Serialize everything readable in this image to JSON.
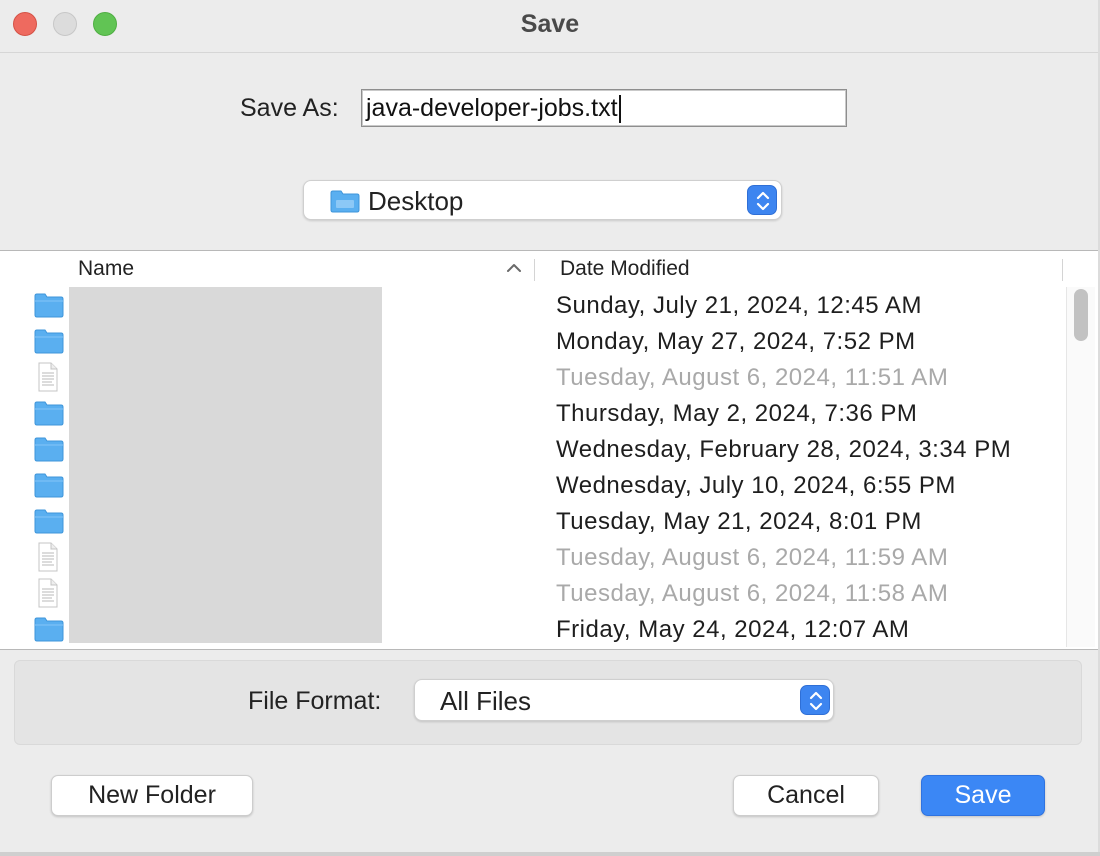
{
  "window": {
    "title": "Save"
  },
  "save_as": {
    "label": "Save As:",
    "value": "java-developer-jobs.txt"
  },
  "location": {
    "label": "Desktop",
    "icon": "folder-icon"
  },
  "browser": {
    "columns": {
      "name": "Name",
      "date_modified": "Date Modified"
    },
    "sort": "ascending",
    "rows": [
      {
        "type": "folder",
        "date": "Sunday, July 21, 2024, 12:45 AM",
        "enabled": true
      },
      {
        "type": "folder",
        "date": "Monday, May 27, 2024, 7:52 PM",
        "enabled": true
      },
      {
        "type": "file",
        "date": "Tuesday, August 6, 2024, 11:51 AM",
        "enabled": false
      },
      {
        "type": "folder",
        "date": "Thursday, May 2, 2024, 7:36 PM",
        "enabled": true
      },
      {
        "type": "folder",
        "date": "Wednesday, February 28, 2024, 3:34 PM",
        "enabled": true
      },
      {
        "type": "folder",
        "date": "Wednesday, July 10, 2024, 6:55 PM",
        "enabled": true
      },
      {
        "type": "folder",
        "date": "Tuesday, May 21, 2024, 8:01 PM",
        "enabled": true
      },
      {
        "type": "file",
        "date": "Tuesday, August 6, 2024, 11:59 AM",
        "enabled": false
      },
      {
        "type": "file",
        "date": "Tuesday, August 6, 2024, 11:58 AM",
        "enabled": false
      },
      {
        "type": "folder",
        "date": "Friday, May 24, 2024, 12:07 AM",
        "enabled": true
      }
    ]
  },
  "file_format": {
    "label": "File Format:",
    "value": "All Files"
  },
  "buttons": {
    "new_folder": "New Folder",
    "cancel": "Cancel",
    "save": "Save"
  },
  "colors": {
    "accent": "#3b87f5",
    "close": "#ee6a5f",
    "zoom": "#61c454",
    "folder": "#5aaff0",
    "disabled_text": "#a9a9a9"
  }
}
